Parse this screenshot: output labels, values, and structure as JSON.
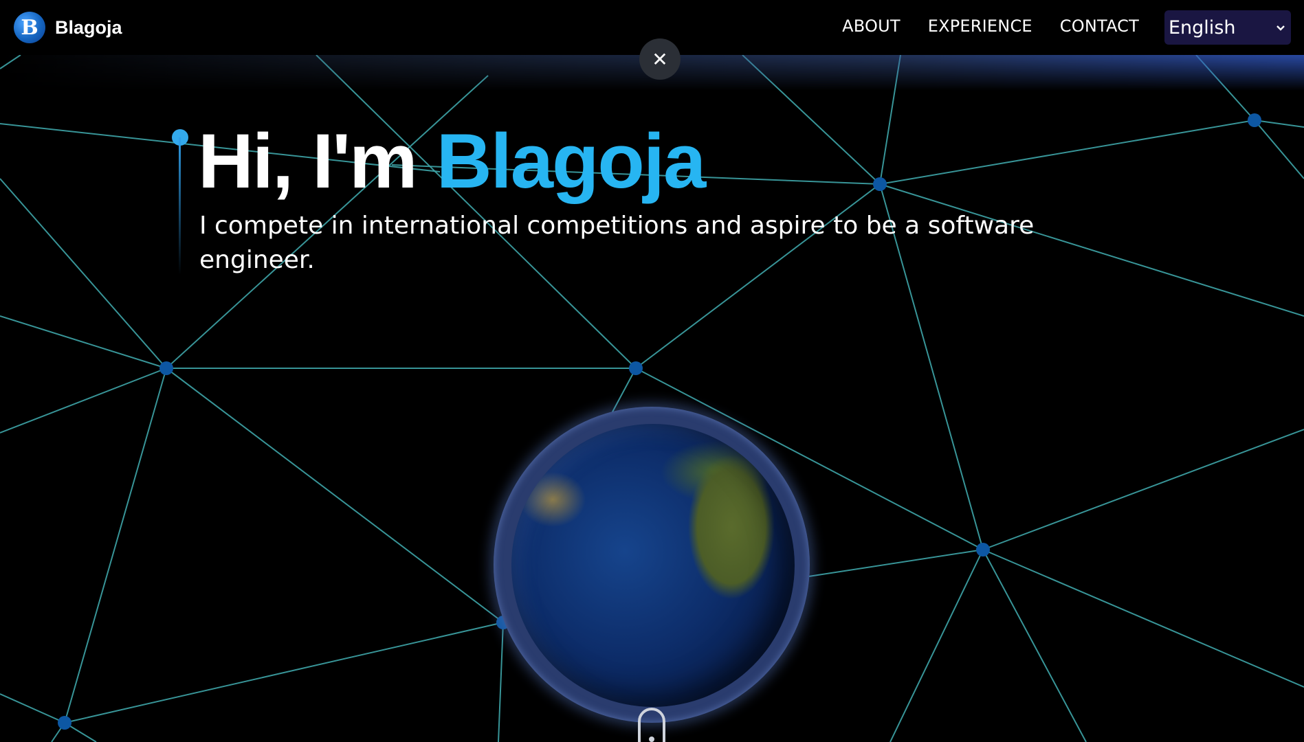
{
  "navbar": {
    "brand_initial": "B",
    "brand_name": "Blagoja",
    "links": [
      "ABOUT",
      "EXPERIENCE",
      "CONTACT"
    ],
    "language": {
      "selected": "English",
      "chevron_icon": "chevron-down-icon"
    }
  },
  "overlay": {
    "close_icon": "close-icon",
    "close_glyph": "✕"
  },
  "hero": {
    "greeting": "Hi, I'm",
    "name": "Blagoja",
    "subtitle": "I compete in international competitions and aspire to be a software engineer."
  },
  "colors": {
    "accent": "#27b5f2",
    "network_line": "#3fa6a9",
    "network_node": "#0d57a3",
    "language_bg": "#1a1642"
  }
}
